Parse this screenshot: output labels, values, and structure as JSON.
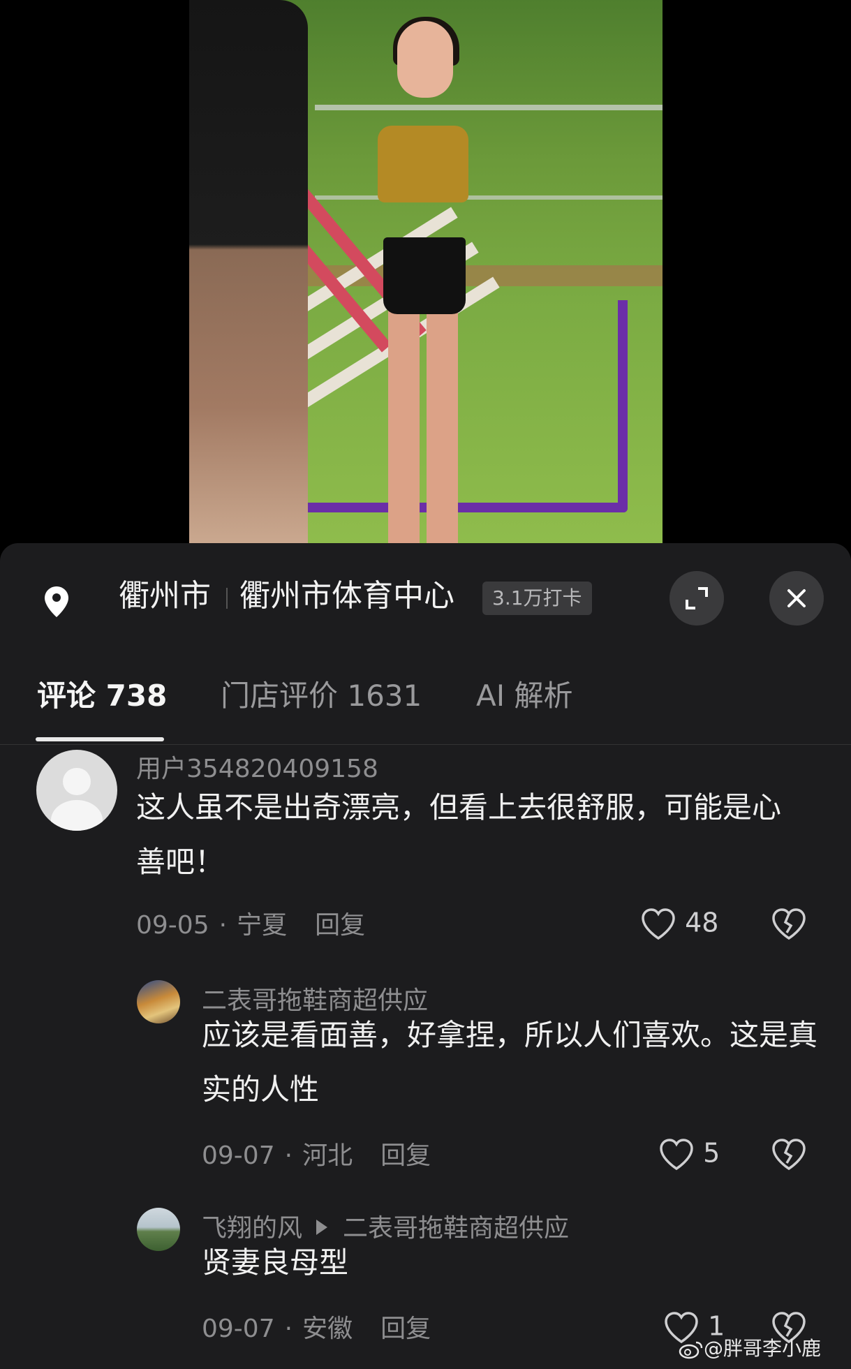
{
  "location": {
    "city": "衢州市",
    "place": "衢州市体育中心",
    "checkins": "3.1万打卡"
  },
  "tabs": [
    {
      "label": "评论 738",
      "active": true
    },
    {
      "label": "门店评价 1631",
      "active": false
    },
    {
      "label": "AI 解析",
      "active": false
    }
  ],
  "comments": [
    {
      "user": "用户354820409158",
      "text": "这人虽不是出奇漂亮，但看上去很舒服，可能是心善吧！",
      "date": "09-05",
      "region": "宁夏",
      "reply": "回复",
      "likes": "48"
    },
    {
      "user": "二表哥拖鞋商超供应",
      "text": "应该是看面善，好拿捏，所以人们喜欢。这是真实的人性",
      "date": "09-07",
      "region": "河北",
      "reply": "回复",
      "likes": "5"
    },
    {
      "user": "飞翔的风",
      "reply_to": "二表哥拖鞋商超供应",
      "text": "贤妻良母型",
      "date": "09-07",
      "region": "安徽",
      "reply": "回复",
      "likes": "1"
    }
  ],
  "watermark": "@胖哥李小鹿",
  "colors": {
    "sheet_bg": "#1c1c1e",
    "hurdle_rack": "#6b2ea8"
  }
}
